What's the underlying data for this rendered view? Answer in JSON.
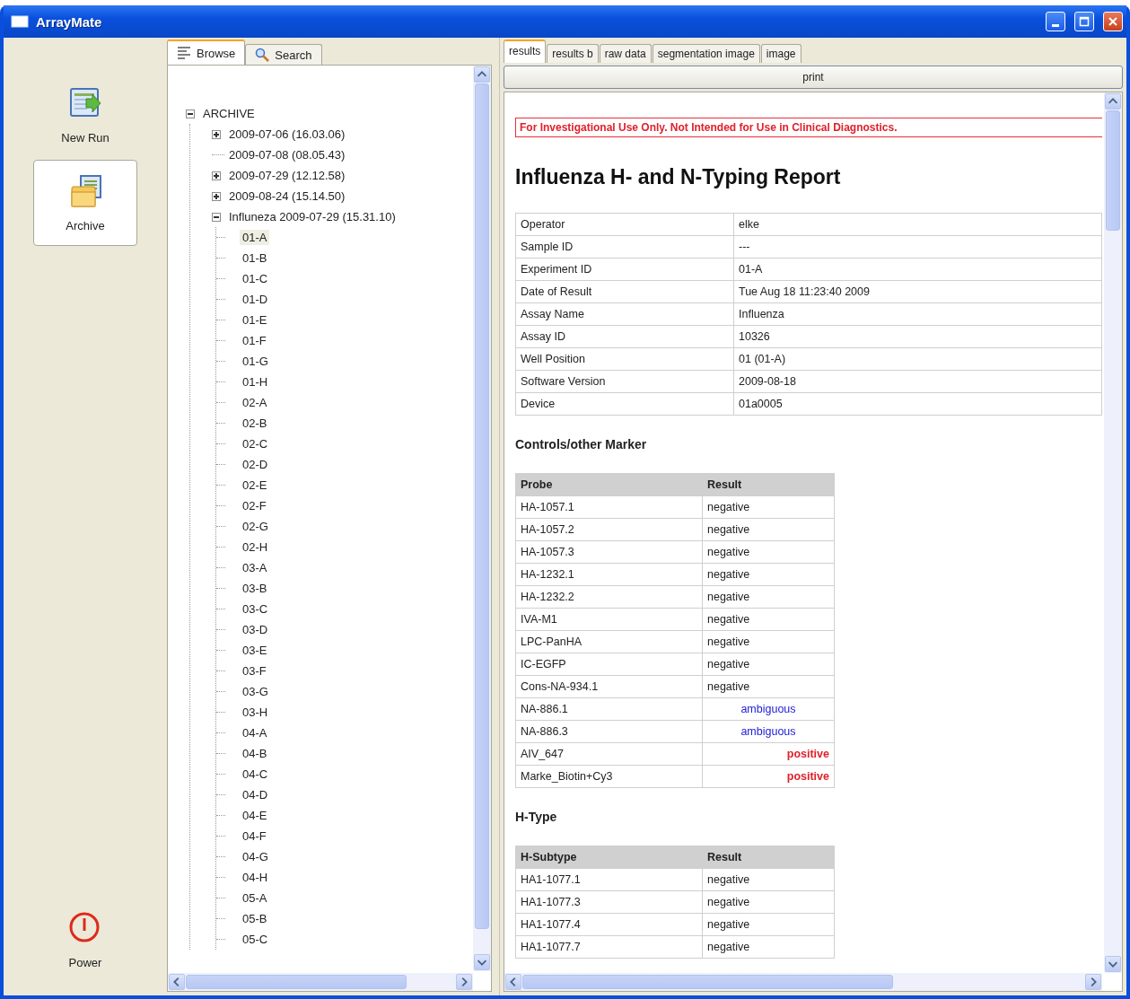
{
  "window": {
    "title": "ArrayMate"
  },
  "nav": [
    {
      "label": "New Run",
      "kind": "run",
      "selected": false
    },
    {
      "label": "Archive",
      "kind": "archive",
      "selected": true
    },
    {
      "label": "Power",
      "kind": "power",
      "selected": false
    }
  ],
  "browser_tabs": [
    {
      "label": "Browse",
      "kind": "browse",
      "selected": true
    },
    {
      "label": "Search",
      "kind": "search",
      "selected": false
    }
  ],
  "tree": [
    {
      "label": "ARCHIVE",
      "kind": "group",
      "expanded": true,
      "selected": false,
      "children": [
        {
          "label": "2009-07-06 (16.03.06)",
          "kind": "group",
          "expanded": false,
          "selected": false
        },
        {
          "label": "2009-07-08 (08.05.43)",
          "kind": "leaf",
          "selected": false
        },
        {
          "label": "2009-07-29 (12.12.58)",
          "kind": "group",
          "expanded": false,
          "selected": false
        },
        {
          "label": "2009-08-24 (15.14.50)",
          "kind": "group",
          "expanded": false,
          "selected": false
        },
        {
          "label": "Influneza 2009-07-29 (15.31.10)",
          "kind": "group",
          "expanded": true,
          "selected": false,
          "children": [
            {
              "label": "01-A",
              "kind": "leaf",
              "selected": true
            },
            {
              "label": "01-B",
              "kind": "leaf",
              "selected": false
            },
            {
              "label": "01-C",
              "kind": "leaf",
              "selected": false
            },
            {
              "label": "01-D",
              "kind": "leaf",
              "selected": false
            },
            {
              "label": "01-E",
              "kind": "leaf",
              "selected": false
            },
            {
              "label": "01-F",
              "kind": "leaf",
              "selected": false
            },
            {
              "label": "01-G",
              "kind": "leaf",
              "selected": false
            },
            {
              "label": "01-H",
              "kind": "leaf",
              "selected": false
            },
            {
              "label": "02-A",
              "kind": "leaf",
              "selected": false
            },
            {
              "label": "02-B",
              "kind": "leaf",
              "selected": false
            },
            {
              "label": "02-C",
              "kind": "leaf",
              "selected": false
            },
            {
              "label": "02-D",
              "kind": "leaf",
              "selected": false
            },
            {
              "label": "02-E",
              "kind": "leaf",
              "selected": false
            },
            {
              "label": "02-F",
              "kind": "leaf",
              "selected": false
            },
            {
              "label": "02-G",
              "kind": "leaf",
              "selected": false
            },
            {
              "label": "02-H",
              "kind": "leaf",
              "selected": false
            },
            {
              "label": "03-A",
              "kind": "leaf",
              "selected": false
            },
            {
              "label": "03-B",
              "kind": "leaf",
              "selected": false
            },
            {
              "label": "03-C",
              "kind": "leaf",
              "selected": false
            },
            {
              "label": "03-D",
              "kind": "leaf",
              "selected": false
            },
            {
              "label": "03-E",
              "kind": "leaf",
              "selected": false
            },
            {
              "label": "03-F",
              "kind": "leaf",
              "selected": false
            },
            {
              "label": "03-G",
              "kind": "leaf",
              "selected": false
            },
            {
              "label": "03-H",
              "kind": "leaf",
              "selected": false
            },
            {
              "label": "04-A",
              "kind": "leaf",
              "selected": false
            },
            {
              "label": "04-B",
              "kind": "leaf",
              "selected": false
            },
            {
              "label": "04-C",
              "kind": "leaf",
              "selected": false
            },
            {
              "label": "04-D",
              "kind": "leaf",
              "selected": false
            },
            {
              "label": "04-E",
              "kind": "leaf",
              "selected": false
            },
            {
              "label": "04-F",
              "kind": "leaf",
              "selected": false
            },
            {
              "label": "04-G",
              "kind": "leaf",
              "selected": false
            },
            {
              "label": "04-H",
              "kind": "leaf",
              "selected": false
            },
            {
              "label": "05-A",
              "kind": "leaf",
              "selected": false
            },
            {
              "label": "05-B",
              "kind": "leaf",
              "selected": false
            },
            {
              "label": "05-C",
              "kind": "leaf",
              "selected": false
            }
          ]
        }
      ]
    }
  ],
  "report_tabs": [
    {
      "label": "results",
      "selected": true
    },
    {
      "label": "results b",
      "selected": false
    },
    {
      "label": "raw data",
      "selected": false
    },
    {
      "label": "segmentation image",
      "selected": false
    },
    {
      "label": "image",
      "selected": false
    }
  ],
  "print_button": "print",
  "report": {
    "warning": "For Investigational Use Only. Not Intended for  Use in Clinical Diagnostics.",
    "title": "Influenza H- and N-Typing Report",
    "info": [
      [
        "Operator",
        "elke"
      ],
      [
        "Sample ID",
        "---"
      ],
      [
        "Experiment ID",
        "01-A"
      ],
      [
        "Date of Result",
        "Tue Aug 18 11:23:40 2009"
      ],
      [
        "Assay Name",
        "Influenza"
      ],
      [
        "Assay ID",
        "10326"
      ],
      [
        "Well Position",
        "01 (01-A)"
      ],
      [
        "Software Version",
        "2009-08-18"
      ],
      [
        "Device",
        "01a0005"
      ]
    ],
    "sections": [
      {
        "title": "Controls/other Marker",
        "columns": [
          "Probe",
          "Result"
        ],
        "rows": [
          {
            "name": "HA-1057.1",
            "result": "negative",
            "kind": "negative"
          },
          {
            "name": "HA-1057.2",
            "result": "negative",
            "kind": "negative"
          },
          {
            "name": "HA-1057.3",
            "result": "negative",
            "kind": "negative"
          },
          {
            "name": "HA-1232.1",
            "result": "negative",
            "kind": "negative"
          },
          {
            "name": "HA-1232.2",
            "result": "negative",
            "kind": "negative"
          },
          {
            "name": "IVA-M1",
            "result": "negative",
            "kind": "negative"
          },
          {
            "name": "LPC-PanHA",
            "result": "negative",
            "kind": "negative"
          },
          {
            "name": "IC-EGFP",
            "result": "negative",
            "kind": "negative"
          },
          {
            "name": "Cons-NA-934.1",
            "result": "negative",
            "kind": "negative"
          },
          {
            "name": "NA-886.1",
            "result": "ambiguous",
            "kind": "ambiguous"
          },
          {
            "name": "NA-886.3",
            "result": "ambiguous",
            "kind": "ambiguous"
          },
          {
            "name": "AIV_647",
            "result": "positive",
            "kind": "positive"
          },
          {
            "name": "Marke_Biotin+Cy3",
            "result": "positive",
            "kind": "positive"
          }
        ]
      },
      {
        "title": "H-Type",
        "columns": [
          "H-Subtype",
          "Result"
        ],
        "rows": [
          {
            "name": "HA1-1077.1",
            "result": "negative",
            "kind": "negative"
          },
          {
            "name": "HA1-1077.3",
            "result": "negative",
            "kind": "negative"
          },
          {
            "name": "HA1-1077.4",
            "result": "negative",
            "kind": "negative"
          },
          {
            "name": "HA1-1077.7",
            "result": "negative",
            "kind": "negative"
          }
        ]
      }
    ]
  }
}
